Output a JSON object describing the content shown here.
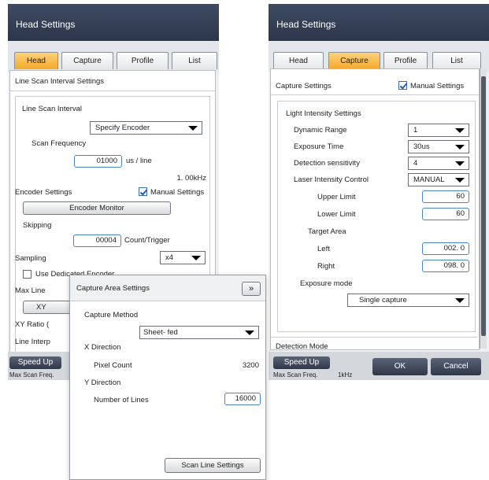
{
  "left": {
    "title": "Head Settings",
    "tabs": [
      "Head",
      "Capture",
      "Profile",
      "List"
    ],
    "section": "Line Scan Interval Settings",
    "line_scan_interval_label": "Line Scan Interval",
    "line_scan_interval_value": "Specify Encoder",
    "scan_frequency_label": "Scan Frequency",
    "scan_frequency_value": "01000",
    "scan_frequency_unit": "us / line",
    "scan_frequency_khz": "1. 00kHz",
    "encoder_settings_label": "Encoder Settings",
    "manual_settings_label": "Manual Settings",
    "encoder_monitor_button": "Encoder Monitor",
    "skipping_label": "Skipping",
    "skipping_value": "00004",
    "skipping_unit": "Count/Trigger",
    "sampling_label": "Sampling",
    "sampling_value": "x4",
    "use_dedicated_encoder": "Use Dedicated Encoder",
    "max_line_label": "Max Line",
    "xy_button": "XY",
    "xy_ratio_label": "XY Ratio (",
    "line_interp_label": "Line Interp",
    "speed_up_button": "Speed Up",
    "max_scan_freq_label": "Max Scan Freq."
  },
  "right": {
    "title": "Head Settings",
    "tabs": [
      "Head",
      "Capture",
      "Profile",
      "List"
    ],
    "section": "Capture Settings",
    "manual_settings_label": "Manual Settings",
    "light_intensity_label": "Light Intensity Settings",
    "dynamic_range_label": "Dynamic Range",
    "dynamic_range_value": "1",
    "exposure_time_label": "Exposure Time",
    "exposure_time_value": "30us",
    "detection_sensitivity_label": "Detection sensitivity",
    "detection_sensitivity_value": "4",
    "laser_intensity_label": "Laser Intensity Control",
    "laser_intensity_value": "MANUAL",
    "upper_limit_label": "Upper Limit",
    "upper_limit_value": "60",
    "lower_limit_label": "Lower Limit",
    "lower_limit_value": "60",
    "target_area_label": "Target Area",
    "left_label": "Left",
    "left_value": "002. 0",
    "right_label": "Right",
    "right_value": "098. 0",
    "exposure_mode_label": "Exposure mode",
    "exposure_mode_value": "Single capture",
    "detection_mode_label": "Detection Mode",
    "speed_up_button": "Speed Up",
    "max_scan_freq_label": "Max Scan Freq.",
    "max_scan_freq_value": "1kHz",
    "ok_button": "OK",
    "cancel_button": "Cancel"
  },
  "popup": {
    "title": "Capture Area Settings",
    "expand_button": "»",
    "capture_method_label": "Capture Method",
    "capture_method_value": "Sheet- fed",
    "x_direction_label": "X Direction",
    "pixel_count_label": "Pixel Count",
    "pixel_count_value": "3200",
    "y_direction_label": "Y Direction",
    "number_of_lines_label": "Number of Lines",
    "number_of_lines_value": "16000",
    "scan_line_settings_button": "Scan Line Settings"
  },
  "colors": {
    "titlebar": "#34405a",
    "active_tab": "#f7b23b",
    "input_border": "#4a86c5"
  }
}
